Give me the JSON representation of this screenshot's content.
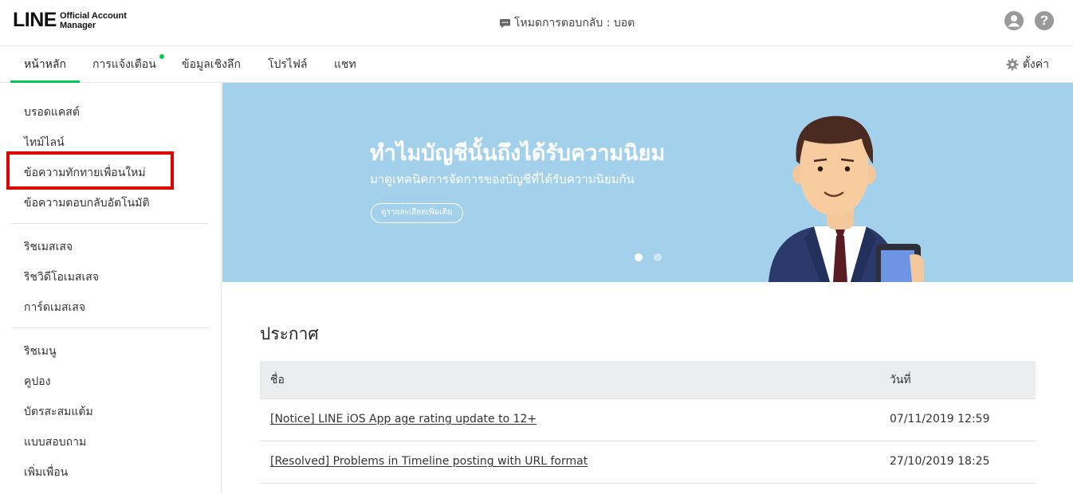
{
  "header": {
    "logo_main": "LINE",
    "logo_sub_line1": "Official Account",
    "logo_sub_line2": "Manager",
    "mode_text": "โหมดการตอบกลับ : บอต"
  },
  "nav": {
    "tabs": [
      {
        "label": "หน้าหลัก",
        "active": true
      },
      {
        "label": "การแจ้งเตือน",
        "has_dot": true
      },
      {
        "label": "ข้อมูลเชิงลึก"
      },
      {
        "label": "โปรไฟล์"
      },
      {
        "label": "แชท"
      }
    ],
    "settings_label": "ตั้งค่า"
  },
  "sidebar": {
    "groups": [
      [
        "บรอดแคสต์",
        "ไทม์ไลน์",
        "ข้อความทักทายเพื่อนใหม่",
        "ข้อความตอบกลับอัตโนมัติ"
      ],
      [
        "ริชเมสเสจ",
        "ริชวิดีโอเมสเสจ",
        "การ์ดเมสเสจ"
      ],
      [
        "ริชเมนู",
        "คูปอง",
        "บัตรสะสมแต้ม",
        "แบบสอบถาม",
        "เพิ่มเพื่อน"
      ]
    ],
    "highlight_color": "#e00000"
  },
  "banner": {
    "title": "ทำไมบัญชีนั้นถึงได้รับความนิยม",
    "subtitle": "มาดูเทคนิคการจัดการของบัญชีที่ได้รับความนิยมกัน",
    "button_label": "ดูรายละเอียดเพิ่มเติม",
    "pager_count": 2,
    "pager_active": 1,
    "background_color": "#a3d1ec"
  },
  "announcements": {
    "title": "ประกาศ",
    "columns": [
      "ชื่อ",
      "วันที่"
    ],
    "rows": [
      {
        "title": "[Notice] LINE iOS App age rating update to 12+",
        "date": "07/11/2019 12:59"
      },
      {
        "title": "[Resolved] Problems in Timeline posting with URL format",
        "date": "27/10/2019 18:25"
      }
    ]
  },
  "colors": {
    "accent_green": "#06c755",
    "icon_gray": "#9a9a9a"
  }
}
